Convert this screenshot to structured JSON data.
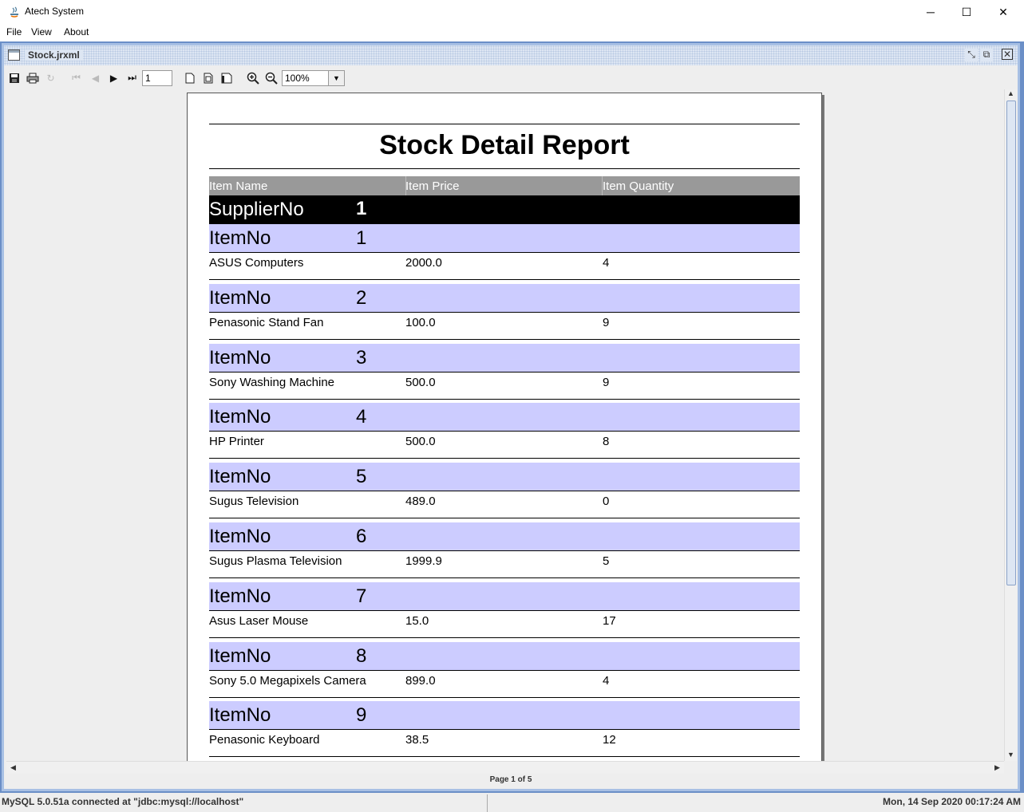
{
  "window": {
    "title": "Atech System",
    "minimize": "─",
    "maximize": "☐",
    "close": "✕"
  },
  "menu": {
    "items": [
      "File",
      "View",
      "About"
    ]
  },
  "frame": {
    "title": "Stock.jrxml"
  },
  "toolbar": {
    "page_value": "1",
    "zoom_value": "100%"
  },
  "report": {
    "title": "Stock Detail Report",
    "columns": [
      "Item Name",
      "Item Price",
      "Item Quantity"
    ],
    "supplier_label": "SupplierNo",
    "supplier_no": "1",
    "item_label": "ItemNo",
    "items": [
      {
        "no": "1",
        "name": "ASUS Computers",
        "price": "2000.0",
        "qty": "4"
      },
      {
        "no": "2",
        "name": "Penasonic Stand Fan",
        "price": "100.0",
        "qty": "9"
      },
      {
        "no": "3",
        "name": "Sony Washing Machine",
        "price": "500.0",
        "qty": "9"
      },
      {
        "no": "4",
        "name": "HP Printer",
        "price": "500.0",
        "qty": "8"
      },
      {
        "no": "5",
        "name": "Sugus Television",
        "price": "489.0",
        "qty": "0"
      },
      {
        "no": "6",
        "name": "Sugus Plasma Television",
        "price": "1999.9",
        "qty": "5"
      },
      {
        "no": "7",
        "name": "Asus Laser Mouse",
        "price": "15.0",
        "qty": "17"
      },
      {
        "no": "8",
        "name": "Sony 5.0 Megapixels Camera",
        "price": "899.0",
        "qty": "4"
      },
      {
        "no": "9",
        "name": "Penasonic Keyboard",
        "price": "38.5",
        "qty": "12"
      }
    ]
  },
  "viewer": {
    "page_indicator": "Page 1 of 5"
  },
  "status": {
    "left": "MySQL 5.0.51a connected at \"jdbc:mysql://localhost\"",
    "right": "Mon, 14 Sep 2020 00:17:24 AM"
  },
  "colors": {
    "item_band": "#ccccff",
    "column_header": "#999999",
    "supplier_band": "#000000"
  }
}
